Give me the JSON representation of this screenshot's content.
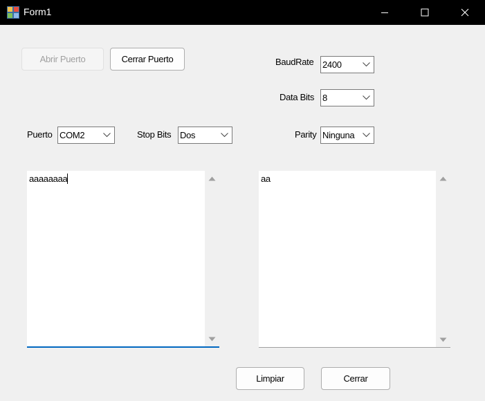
{
  "window": {
    "title": "Form1",
    "minimize_icon": "minimize-icon",
    "maximize_icon": "maximize-icon",
    "close_icon": "close-icon"
  },
  "buttons": {
    "open_port": "Abrir Puerto",
    "close_port": "Cerrar Puerto",
    "clear": "Limpiar",
    "close": "Cerrar"
  },
  "labels": {
    "baudrate": "BaudRate",
    "data_bits": "Data Bits",
    "port": "Puerto",
    "stop_bits": "Stop Bits",
    "parity": "Parity"
  },
  "combos": {
    "baudrate": "2400",
    "data_bits": "8",
    "port": "COM2",
    "stop_bits": "Dos",
    "parity": "Ninguna"
  },
  "textboxes": {
    "send": "aaaaaaaa",
    "receive": "aa"
  },
  "colors": {
    "titlebar": "#000000",
    "focus_border": "#0067c0"
  }
}
